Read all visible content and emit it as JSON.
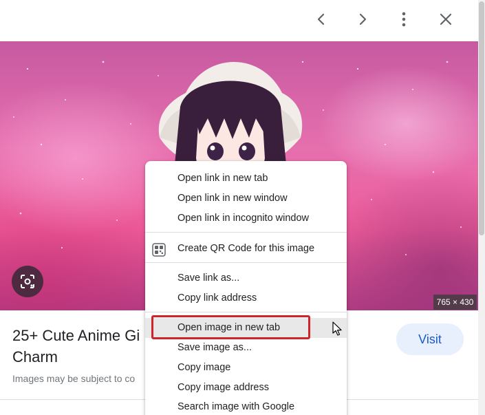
{
  "toolbar": {
    "prev_icon": "chevron-left-icon",
    "next_icon": "chevron-right-icon",
    "more_icon": "more-vert-icon",
    "close_icon": "close-icon"
  },
  "preview": {
    "dimensions": "765 × 430",
    "lens_icon": "google-lens-icon"
  },
  "result": {
    "title": "25+ Cute Anime Gi",
    "title_line2": "Charm",
    "subtext": "Images may be subject to co",
    "visit_label": "Visit"
  },
  "context_menu": {
    "items": [
      "Open link in new tab",
      "Open link in new window",
      "Open link in incognito window",
      "Create QR Code for this image",
      "Save link as...",
      "Copy link address",
      "Open image in new tab",
      "Save image as...",
      "Copy image",
      "Copy image address",
      "Search image with Google"
    ],
    "highlighted_item": "Open image in new tab",
    "highlight_color": "#d0232a"
  },
  "colors": {
    "visit_bg": "#e8f0fe",
    "visit_text": "#1a5ac8",
    "lens_bg": "#4e2a40"
  }
}
